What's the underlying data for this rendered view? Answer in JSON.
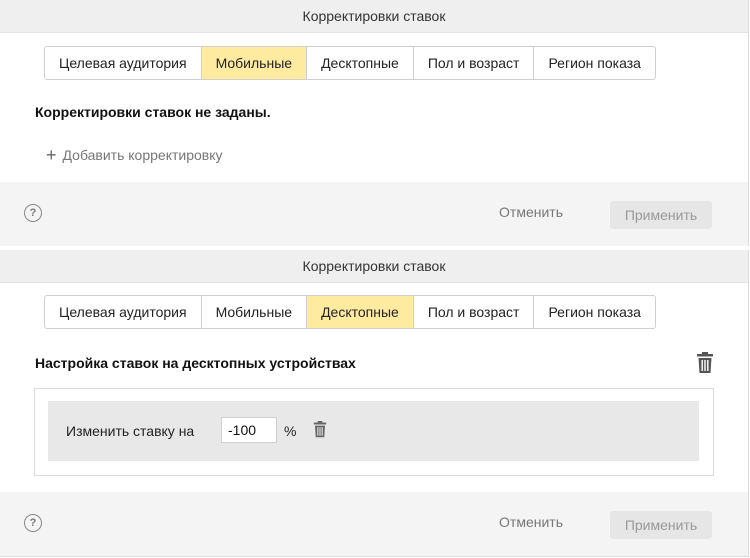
{
  "panel1": {
    "header_title": "Корректировки ставок",
    "tabs": [
      {
        "label": "Целевая аудитория",
        "active": false
      },
      {
        "label": "Мобильные",
        "active": true
      },
      {
        "label": "Десктопные",
        "active": false
      },
      {
        "label": "Пол и возраст",
        "active": false
      },
      {
        "label": "Регион показа",
        "active": false
      }
    ],
    "message": "Корректировки ставок не заданы.",
    "add_link": "Добавить корректировку",
    "help_icon": "?",
    "cancel_label": "Отменить",
    "apply_label": "Применить"
  },
  "panel2": {
    "header_title": "Корректировки ставок",
    "tabs": [
      {
        "label": "Целевая аудитория",
        "active": false
      },
      {
        "label": "Мобильные",
        "active": false
      },
      {
        "label": "Десктопные",
        "active": true
      },
      {
        "label": "Пол и возраст",
        "active": false
      },
      {
        "label": "Регион показа",
        "active": false
      }
    ],
    "section_title": "Настройка ставок на десктопных устройствах",
    "rule": {
      "label": "Изменить ставку на",
      "value": "-100",
      "unit": "%"
    },
    "help_icon": "?",
    "cancel_label": "Отменить",
    "apply_label": "Применить"
  },
  "icons": {
    "help": "help-circle-icon",
    "trash": "trash-icon",
    "plus": "plus-icon"
  },
  "colors": {
    "active_tab": "#ffeba0",
    "header_bg": "#efefef",
    "footer_bg": "#f4f4f4"
  }
}
